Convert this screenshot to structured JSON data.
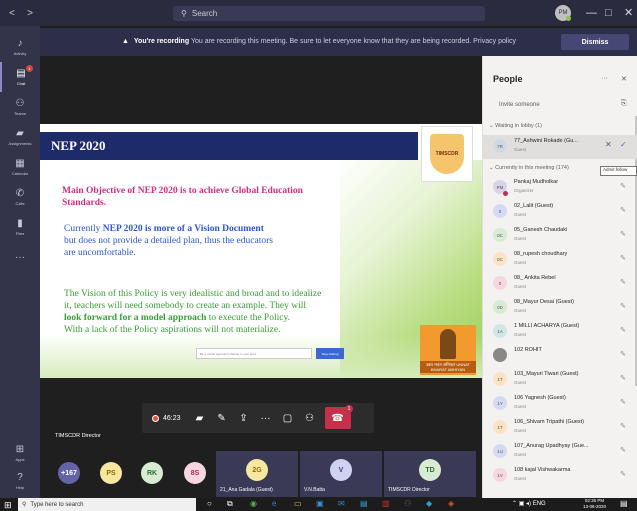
{
  "titlebar": {
    "search_placeholder": "Search",
    "avatar_initials": "PM",
    "back": "<",
    "forward": ">",
    "minimize": "—",
    "maximize": "□",
    "close": "✕"
  },
  "rail": {
    "items": [
      {
        "label": "Activity",
        "icon": "bell-icon",
        "glyph": "♪"
      },
      {
        "label": "Chat",
        "icon": "chat-icon",
        "glyph": "▤",
        "badge": "1"
      },
      {
        "label": "Teams",
        "icon": "teams-icon",
        "glyph": "⚇"
      },
      {
        "label": "Assignments",
        "icon": "assignments-icon",
        "glyph": "▰"
      },
      {
        "label": "Calendar",
        "icon": "calendar-icon",
        "glyph": "▦"
      },
      {
        "label": "Calls",
        "icon": "phone-icon",
        "glyph": "✆"
      },
      {
        "label": "Files",
        "icon": "files-icon",
        "glyph": "▮"
      },
      {
        "label": "",
        "icon": "more-icon",
        "glyph": "···"
      }
    ],
    "bottom": [
      {
        "label": "Apps",
        "icon": "apps-icon",
        "glyph": "⊞"
      },
      {
        "label": "Help",
        "icon": "help-icon",
        "glyph": "?"
      }
    ]
  },
  "banner": {
    "bold": "You're recording",
    "text": "You are recording this meeting. Be sure to let everyone know that they are being recorded. Privacy policy",
    "dismiss": "Dismiss"
  },
  "slide": {
    "title": "NEP 2020",
    "line1": "Main Objective of NEP 2020 is to achieve Global Education",
    "line2": "Standards.",
    "blue1_pre": "Currently ",
    "blue1_bold": "NEP 2020 is more of a Vision Document",
    "blue2": "but does not provide a detailed plan, thus the educators",
    "blue3": "are uncomfortable.",
    "green1": "The Vision of this Policy  is very idealistic and broad and to idealize",
    "green2": "it, teachers will need somebody to create an example. They will",
    "green3_bold": "look forward for a model approach",
    "green3_rest": " to execute the Policy.",
    "green4": "With a lack of the Policy aspirations will not materialize.",
    "logo_text": "TIMSCDR",
    "gandhi_text": "उन्नत भारत अभियान UNNAT BHARAT ABHIYAN",
    "inner_search": "Be a model approach sharing in your area",
    "inner_button": "Stop sharing"
  },
  "controls": {
    "timer": "46:23",
    "participants_badge": "1",
    "presenter_label": "TIMSCDR Director"
  },
  "participants_row": [
    {
      "initials": "+167",
      "bg": "#6264a7",
      "fg": "#ffffff"
    },
    {
      "initials": "PS",
      "bg": "#f7e7a1",
      "fg": "#8a6d00"
    },
    {
      "initials": "RK",
      "bg": "#d7ecd3",
      "fg": "#2f6b2f"
    },
    {
      "initials": "8S",
      "bg": "#f6d6e0",
      "fg": "#9a2f54"
    }
  ],
  "tiles": [
    {
      "initials": "2G",
      "name": "21_Ana Gadala (Guest)",
      "bg": "#f7e7a1",
      "fg": "#8a6d00"
    },
    {
      "initials": "V",
      "name": "V.N.Batta",
      "bg": "#cfd3f0",
      "fg": "#3d3f8f"
    },
    {
      "initials": "TD",
      "name": "TIMSCDR Director",
      "bg": "#d7ecd3",
      "fg": "#2f6b2f"
    }
  ],
  "people": {
    "title": "People",
    "invite": "Invite someone",
    "lobby_header": "Waiting in lobby (1)",
    "lobby": [
      {
        "initials": "7R",
        "name": "77_Ashwini Rokade (Gu...",
        "role": "Guest",
        "bg": "#cfd9e6"
      }
    ],
    "tooltip": "Admit fellow",
    "meeting_header": "Currently in this meeting (174)",
    "members": [
      {
        "initials": "PM",
        "name": "Pankaj Mudholkar",
        "role": "Organizer",
        "bg": "#d9d3ea"
      },
      {
        "initials": "0",
        "name": "02_Lalit (Guest)",
        "role": "Guest",
        "bg": "#d6dbf5"
      },
      {
        "initials": "0C",
        "name": "05_Ganesh Chaudaki",
        "role": "Guest",
        "bg": "#d7ecd3"
      },
      {
        "initials": "0C",
        "name": "08_rupesh choudhary",
        "role": "Guest",
        "bg": "#fbe3c4"
      },
      {
        "initials": "0",
        "name": "08_ Ankita Rebel",
        "role": "Guest",
        "bg": "#f6d6e0"
      },
      {
        "initials": "0D",
        "name": "08_Mayur Desai (Guest)",
        "role": "Guest",
        "bg": "#d7ecd3"
      },
      {
        "initials": "1A",
        "name": "1 MILLI ACHARYA (Guest)",
        "role": "Guest",
        "bg": "#cfe8e6"
      },
      {
        "initials": "",
        "name": "102 ROHIT",
        "role": "",
        "bg": "#8a8886"
      },
      {
        "initials": "1T",
        "name": "103_Mayuri Tiwari (Guest)",
        "role": "Guest",
        "bg": "#fbe3c4"
      },
      {
        "initials": "1Y",
        "name": "106 Yagnesh (Guest)",
        "role": "Guest",
        "bg": "#d6dbf5"
      },
      {
        "initials": "1T",
        "name": "106_Shivam Tripathi (Guest)",
        "role": "Guest",
        "bg": "#fbe3c4"
      },
      {
        "initials": "1U",
        "name": "107_Anurag Upadhyay (Gue...",
        "role": "Guest",
        "bg": "#d6dbf5"
      },
      {
        "initials": "1V",
        "name": "108 kajal Vishwakarma",
        "role": "Guest",
        "bg": "#f6d6e0"
      }
    ]
  },
  "taskbar": {
    "search": "Type here to search",
    "time": "02:35 PM",
    "date": "13-06-2020",
    "tray": "ENG"
  },
  "colors": {
    "accent": "#6264a7",
    "hangup": "#c4314b",
    "slide_title_bar": "#1e2b6b",
    "slide_pink": "#d2307a",
    "slide_blue": "#2d55d6",
    "slide_green": "#35a135"
  }
}
